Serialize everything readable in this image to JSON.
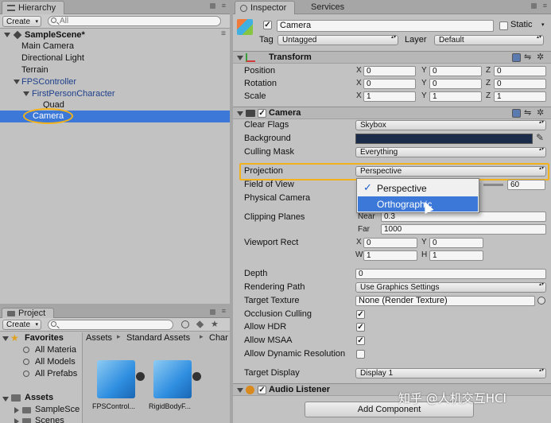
{
  "hierarchy": {
    "tab": "Hierarchy",
    "create": "Create",
    "search_placeholder": "All",
    "scene": "SampleScene*",
    "items": [
      "Main Camera",
      "Directional Light",
      "Terrain",
      "FPSController",
      "FirstPersonCharacter",
      "Quad",
      "Camera"
    ]
  },
  "project": {
    "tab": "Project",
    "create": "Create",
    "favorites": "Favorites",
    "fav_items": [
      "All Materia",
      "All Models",
      "All Prefabs"
    ],
    "assets": "Assets",
    "asset_items": [
      "SampleSce",
      "Scenes"
    ],
    "breadcrumb": [
      "Assets",
      "Standard Assets",
      "Char"
    ],
    "files": [
      "FPSControl...",
      "RigidBodyF..."
    ]
  },
  "inspector": {
    "tabs": [
      "Inspector",
      "Services"
    ],
    "object_name": "Camera",
    "static_label": "Static",
    "tag_label": "Tag",
    "tag_value": "Untagged",
    "layer_label": "Layer",
    "layer_value": "Default",
    "transform": {
      "title": "Transform",
      "rows": [
        {
          "label": "Position",
          "x": "0",
          "y": "0",
          "z": "0"
        },
        {
          "label": "Rotation",
          "x": "0",
          "y": "0",
          "z": "0"
        },
        {
          "label": "Scale",
          "x": "1",
          "y": "1",
          "z": "1"
        }
      ]
    },
    "camera": {
      "title": "Camera",
      "clear_flags_label": "Clear Flags",
      "clear_flags": "Skybox",
      "background_label": "Background",
      "background_color": "#1a2c4a",
      "culling_mask_label": "Culling Mask",
      "culling_mask": "Everything",
      "projection_label": "Projection",
      "projection": "Perspective",
      "fov_label": "Field of View",
      "fov": "60",
      "physical_label": "Physical Camera",
      "clipping_label": "Clipping Planes",
      "near_label": "Near",
      "near": "0.3",
      "far_label": "Far",
      "far": "1000",
      "viewport_label": "Viewport Rect",
      "vp_x": "0",
      "vp_y": "0",
      "vp_w": "1",
      "vp_h": "1",
      "depth_label": "Depth",
      "depth": "0",
      "rendering_label": "Rendering Path",
      "rendering": "Use Graphics Settings",
      "target_texture_label": "Target Texture",
      "target_texture": "None (Render Texture)",
      "occlusion_label": "Occlusion Culling",
      "hdr_label": "Allow HDR",
      "msaa_label": "Allow MSAA",
      "dynres_label": "Allow Dynamic Resolution",
      "display_label": "Target Display",
      "display": "Display 1"
    },
    "audio_listener": "Audio Listener",
    "add_component": "Add Component"
  },
  "popup": {
    "options": [
      "Perspective",
      "Orthographic"
    ],
    "checked_index": 0
  },
  "watermark": "知乎 @人机交互HCI",
  "colors": {
    "selection": "#3c78d8",
    "highlight_border": "#f2b21b",
    "panel_bg": "#c2c2c2"
  }
}
